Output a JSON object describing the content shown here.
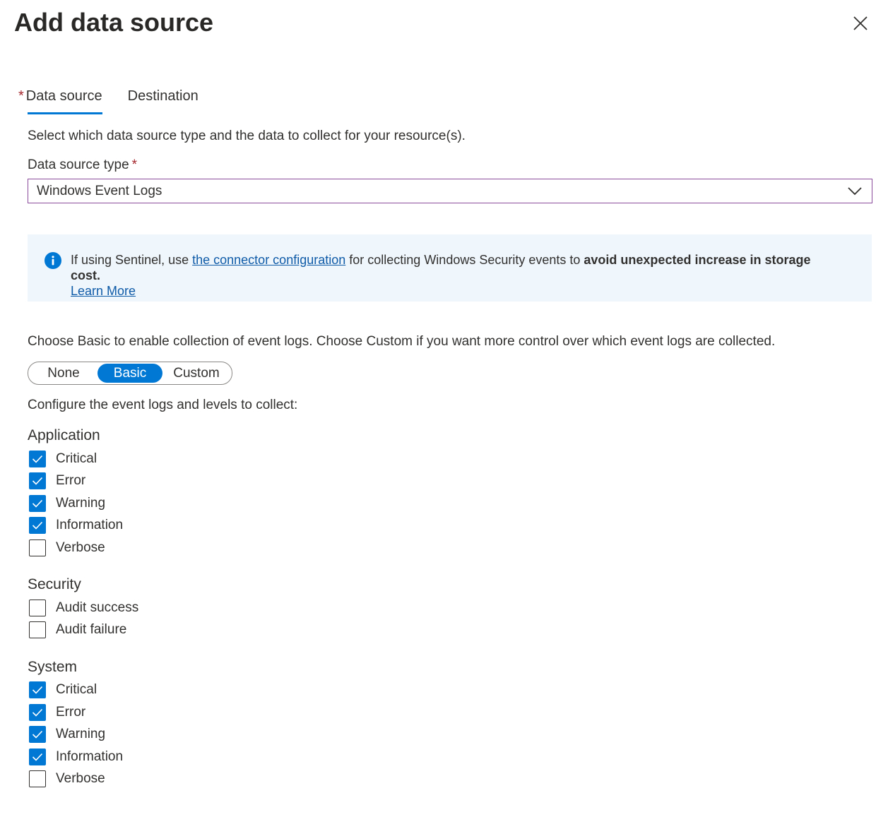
{
  "header": {
    "title": "Add data source",
    "close_icon": "close-icon"
  },
  "tabs": [
    {
      "label": "Data source",
      "required_mark": "*",
      "active": true
    },
    {
      "label": "Destination",
      "active": false
    }
  ],
  "description": "Select which data source type and the data to collect for your resource(s).",
  "data_source_type": {
    "label": "Data source type",
    "required_mark": "*",
    "value": "Windows Event Logs",
    "chevron_icon": "chevron-down-icon"
  },
  "info": {
    "icon": "info-icon",
    "text_1": "If using Sentinel, use ",
    "link": "the connector configuration",
    "text_2": " for collecting Windows Security events to ",
    "bold": "avoid unexpected increase in storage cost.",
    "learn_more": "Learn More",
    "accent_color": "#0078d4"
  },
  "choose_text": "Choose Basic to enable collection of event logs. Choose Custom if you want more control over which event logs are collected.",
  "mode": {
    "options": [
      "None",
      "Basic",
      "Custom"
    ],
    "selected": "Basic"
  },
  "config_text": "Configure the event logs and levels to collect:",
  "groups": {
    "application": {
      "title": "Application",
      "items": [
        {
          "label": "Critical",
          "checked": true
        },
        {
          "label": "Error",
          "checked": true
        },
        {
          "label": "Warning",
          "checked": true
        },
        {
          "label": "Information",
          "checked": true
        },
        {
          "label": "Verbose",
          "checked": false
        }
      ]
    },
    "security": {
      "title": "Security",
      "items": [
        {
          "label": "Audit success",
          "checked": false
        },
        {
          "label": "Audit failure",
          "checked": false
        }
      ]
    },
    "system": {
      "title": "System",
      "items": [
        {
          "label": "Critical",
          "checked": true
        },
        {
          "label": "Error",
          "checked": true
        },
        {
          "label": "Warning",
          "checked": true
        },
        {
          "label": "Information",
          "checked": true
        },
        {
          "label": "Verbose",
          "checked": false
        }
      ]
    }
  },
  "colors": {
    "primary": "#0078d4",
    "required": "#a4262c",
    "info_bg": "#eff6fc",
    "link": "#0f5ba8"
  }
}
